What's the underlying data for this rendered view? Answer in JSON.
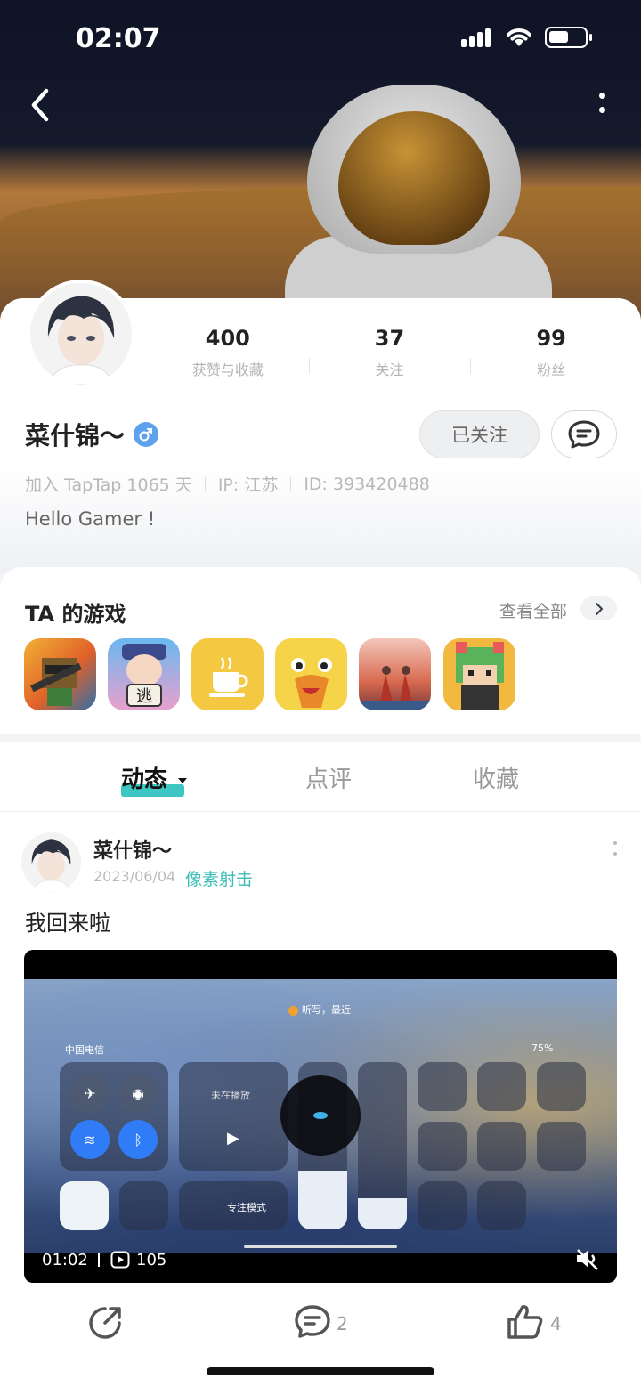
{
  "status_bar": {
    "time": "02:07"
  },
  "profile": {
    "stats": [
      {
        "value": "400",
        "label": "获赞与收藏"
      },
      {
        "value": "37",
        "label": "关注"
      },
      {
        "value": "99",
        "label": "粉丝"
      }
    ],
    "username": "菜什锦～",
    "follow_label": "已关注",
    "join_days": "加入 TapTap 1065 天",
    "ip": "IP: 江苏",
    "user_id": "ID: 393420488",
    "bio": "Hello Gamer !"
  },
  "games": {
    "title": "TA 的游戏",
    "view_all": "查看全部",
    "icons": [
      "pixel-gunner-game-icon",
      "escape-game-icon",
      "coffee-game-icon",
      "duck-game-icon",
      "sky-game-icon",
      "pixel-cat-game-icon"
    ]
  },
  "tabs": [
    {
      "label": "动态",
      "active": true
    },
    {
      "label": "点评",
      "active": false
    },
    {
      "label": "收藏",
      "active": false
    }
  ],
  "post": {
    "author": "菜什锦～",
    "date": "2023/06/04",
    "tag": "像素射击",
    "text": "我回来啦",
    "video": {
      "duration": "01:02",
      "plays": "105",
      "dictation": "听写，最近",
      "carrier": "中国电信",
      "battery": "75%",
      "now_playing": "未在播放",
      "focus": "专注模式"
    },
    "comments": "2",
    "likes": "4"
  },
  "colors": {
    "accent": "#3ec7c2",
    "gender_blue": "#5ea2ee"
  }
}
